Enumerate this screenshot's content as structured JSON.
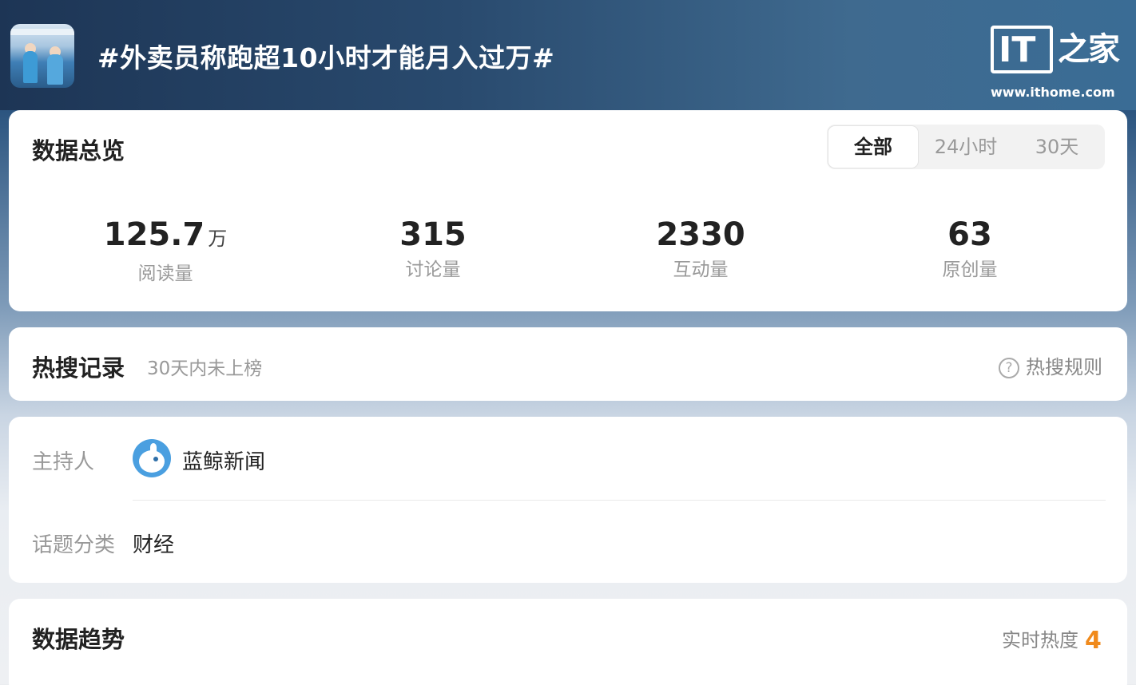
{
  "header": {
    "topic_title": "#外卖员称跑超10小时才能月入过万#",
    "logo_mark": "IT",
    "logo_cn": "之家",
    "logo_url": "www.ithome.com"
  },
  "overview": {
    "title": "数据总览",
    "tabs": [
      {
        "label": "全部",
        "active": true
      },
      {
        "label": "24小时",
        "active": false
      },
      {
        "label": "30天",
        "active": false
      }
    ],
    "stats": [
      {
        "value": "125.7",
        "unit": "万",
        "label": "阅读量"
      },
      {
        "value": "315",
        "unit": "",
        "label": "讨论量"
      },
      {
        "value": "2330",
        "unit": "",
        "label": "互动量"
      },
      {
        "value": "63",
        "unit": "",
        "label": "原创量"
      }
    ]
  },
  "hot_search": {
    "title": "热搜记录",
    "subtitle": "30天内未上榜",
    "rule_label": "热搜规则",
    "rule_icon": "question-circle-icon"
  },
  "info": {
    "host_label": "主持人",
    "host_name": "蓝鲸新闻",
    "host_avatar": "whale-avatar-icon",
    "category_label": "话题分类",
    "category_value": "财经"
  },
  "trend": {
    "title": "数据趋势",
    "realtime_label": "实时热度",
    "realtime_rank": "4"
  },
  "colors": {
    "accent_orange": "#f08a1c",
    "header_blue": "#294a6e",
    "avatar_blue": "#4a9fe0"
  }
}
